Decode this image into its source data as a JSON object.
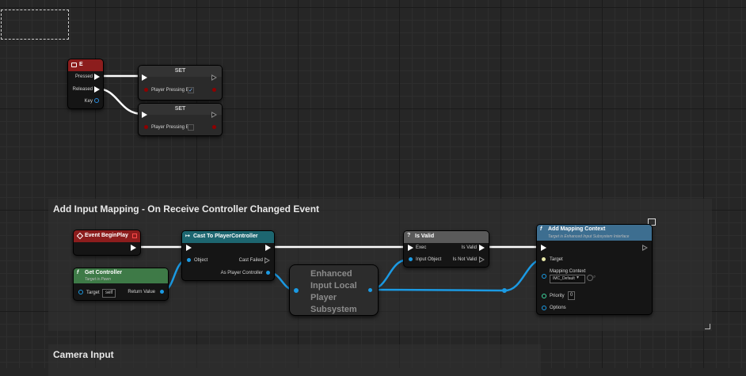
{
  "comments": {
    "input_mapping_title": "Add Input Mapping - On Receive Controller Changed Event",
    "camera_input_title": "Camera Input"
  },
  "nodes": {
    "key_e": {
      "title": "E",
      "pressed": "Pressed",
      "released": "Released",
      "key": "Key"
    },
    "set_1": {
      "title": "SET",
      "var": "Player Pressing E",
      "checked": true
    },
    "set_2": {
      "title": "SET",
      "var": "Player Pressing E",
      "checked": false
    },
    "begin_play": {
      "title": "Event BeginPlay"
    },
    "get_controller": {
      "title": "Get Controller",
      "subtitle": "Target is Pawn",
      "target": "Target",
      "target_value": "self",
      "return": "Return Value"
    },
    "cast": {
      "title": "Cast To PlayerController",
      "object": "Object",
      "cast_failed": "Cast Failed",
      "as_pc": "As Player Controller"
    },
    "subsystem": {
      "title": "Enhanced Input Local Player Subsystem"
    },
    "is_valid": {
      "title": "Is Valid",
      "exec": "Exec",
      "input_object": "Input Object",
      "is_valid": "Is Valid",
      "is_not_valid": "Is Not Valid"
    },
    "add_mapping": {
      "title": "Add Mapping Context",
      "subtitle": "Target is Enhanced Input Subsystem Interface",
      "target": "Target",
      "mapping_context": "Mapping Context",
      "mapping_value": "IMC_Default",
      "priority": "Priority",
      "priority_value": "0",
      "options": "Options"
    }
  },
  "colors": {
    "exec_wire": "#ffffff",
    "object_wire": "#1b9ae3",
    "event_header": "#8c1d1d",
    "cast_header": "#1d6670",
    "pure_header": "#3e7a47",
    "function_header": "#3d6e90",
    "macro_header": "#5a5a5a",
    "bool_pin": "#8e0000"
  }
}
